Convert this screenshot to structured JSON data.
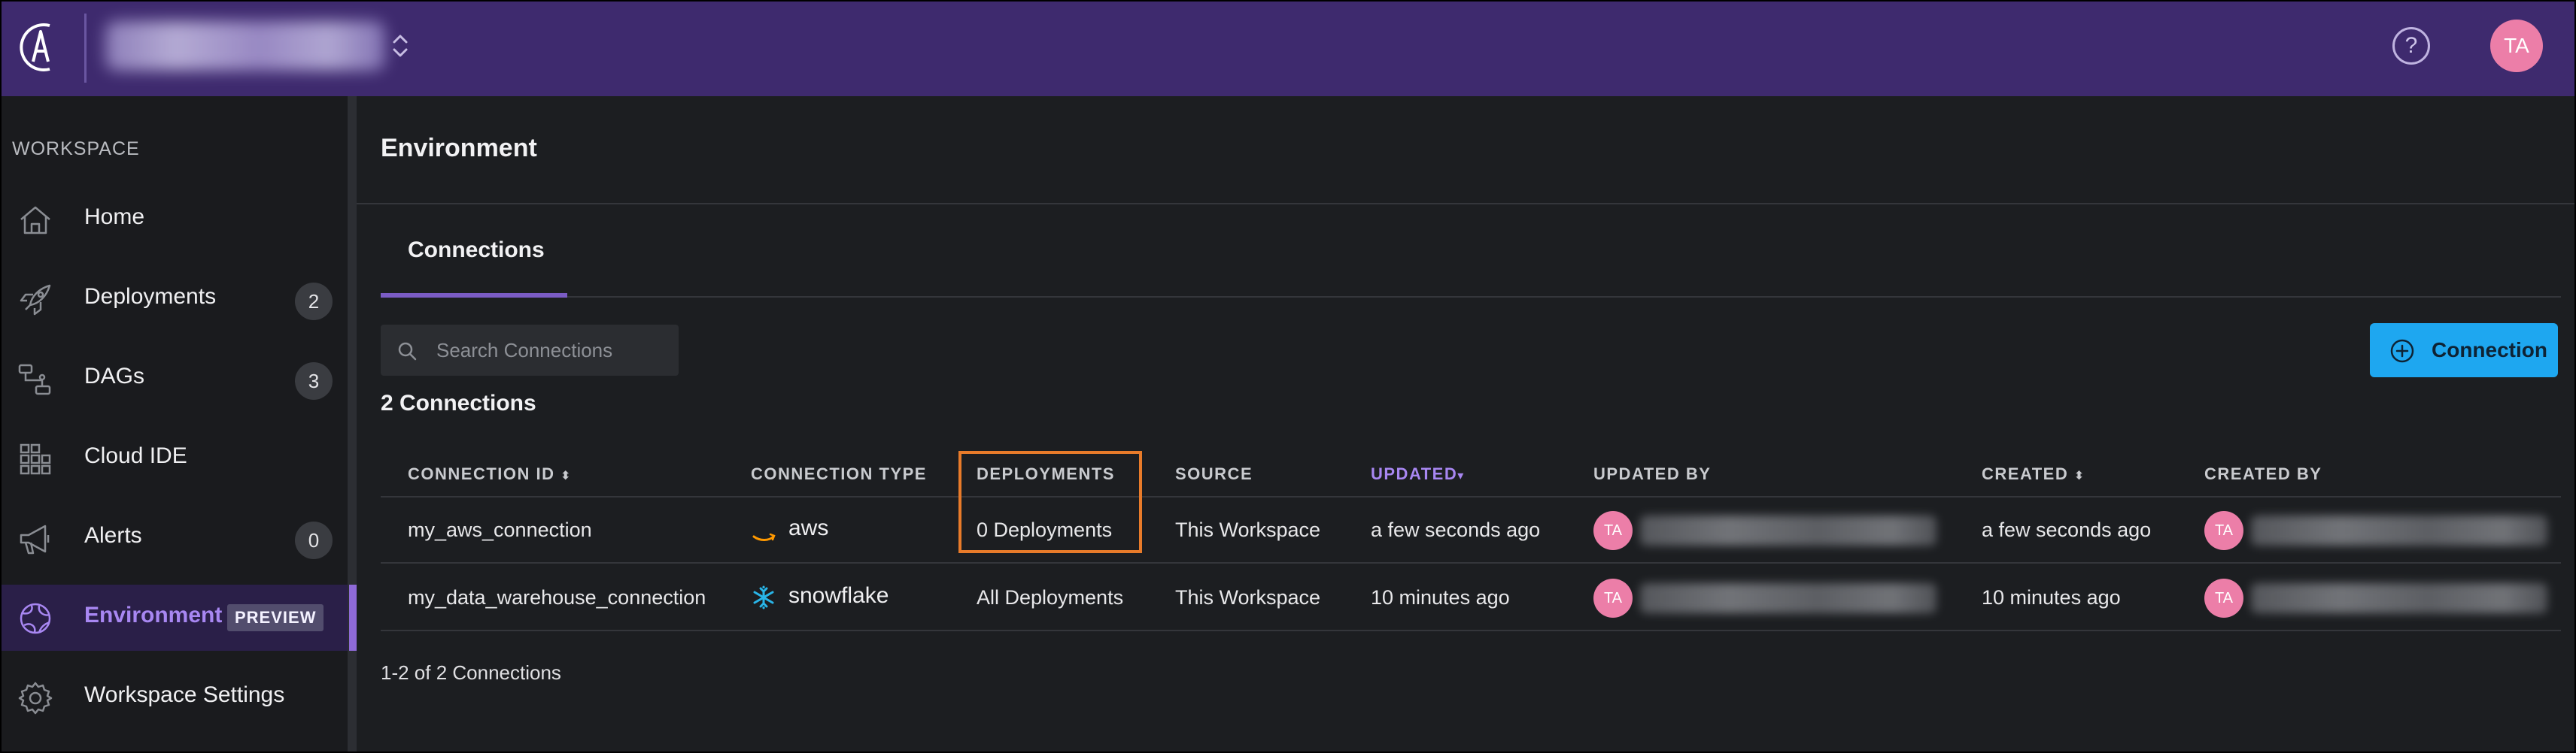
{
  "topbar": {
    "logo": "astronomer-logo",
    "org_selector_icon": "chevron-up-down-icon",
    "help_icon": "help-icon",
    "user_initials": "TA",
    "colors": {
      "background": "#3e2a6e",
      "avatar": "#ec7ea8"
    }
  },
  "sidebar": {
    "section_label": "WORKSPACE",
    "items": [
      {
        "label": "Home",
        "icon": "home-icon"
      },
      {
        "label": "Deployments",
        "icon": "rocket-icon",
        "count": "2"
      },
      {
        "label": "DAGs",
        "icon": "dags-icon",
        "count": "3"
      },
      {
        "label": "Cloud IDE",
        "icon": "grid-icon"
      },
      {
        "label": "Alerts",
        "icon": "megaphone-icon",
        "count": "0"
      },
      {
        "label": "Environment",
        "icon": "globe-icon",
        "badge": "PREVIEW",
        "active": true
      },
      {
        "label": "Workspace Settings",
        "icon": "gear-icon"
      }
    ]
  },
  "main": {
    "title": "Environment",
    "tabs": [
      {
        "label": "Connections",
        "active": true
      }
    ],
    "search": {
      "placeholder": "Search Connections",
      "value": ""
    },
    "add_button_label": "Connection",
    "count_label": "2 Connections",
    "columns": [
      "CONNECTION ID",
      "CONNECTION TYPE",
      "DEPLOYMENTS",
      "SOURCE",
      "UPDATED",
      "UPDATED BY",
      "CREATED",
      "CREATED BY"
    ],
    "sorted_column": "UPDATED",
    "rows": [
      {
        "connection_id": "my_aws_connection",
        "type": "aws",
        "type_icon": "aws-icon",
        "deployments": "0 Deployments",
        "source": "This Workspace",
        "updated": "a few seconds ago",
        "updated_by_initials": "TA",
        "created": "a few seconds ago",
        "created_by_initials": "TA"
      },
      {
        "connection_id": "my_data_warehouse_connection",
        "type": "snowflake",
        "type_icon": "snowflake-icon",
        "deployments": "All Deployments",
        "source": "This Workspace",
        "updated": "10 minutes ago",
        "updated_by_initials": "TA",
        "created": "10 minutes ago",
        "created_by_initials": "TA"
      }
    ],
    "footer": "1-2 of 2 Connections",
    "colors": {
      "accent": "#8f6ad8",
      "button": "#1ea7f0",
      "highlight": "#e87b2a"
    }
  }
}
